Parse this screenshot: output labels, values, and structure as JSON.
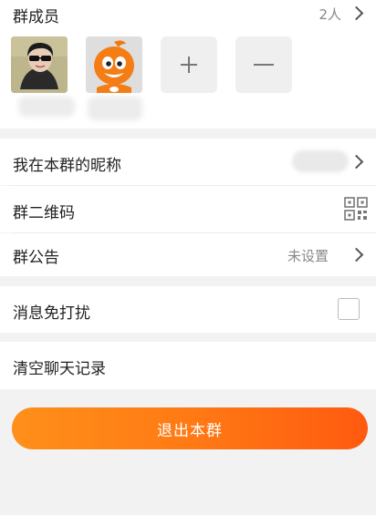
{
  "members": {
    "title": "群成员",
    "count": "2人",
    "items": [
      {
        "icon": "user-photo-avatar"
      },
      {
        "icon": "orange-mascot-avatar"
      }
    ],
    "add_icon": "plus-icon",
    "remove_icon": "minus-icon"
  },
  "settings": {
    "nickname_label": "我在本群的昵称",
    "qrcode_label": "群二维码",
    "notice_label": "群公告",
    "notice_value": "未设置",
    "dnd_label": "消息免打扰",
    "dnd_checked": false,
    "clear_label": "清空聊天记录"
  },
  "exit_button": {
    "label": "退出本群",
    "gradient_from": "#ff8f1a",
    "gradient_to": "#ff5a10"
  }
}
